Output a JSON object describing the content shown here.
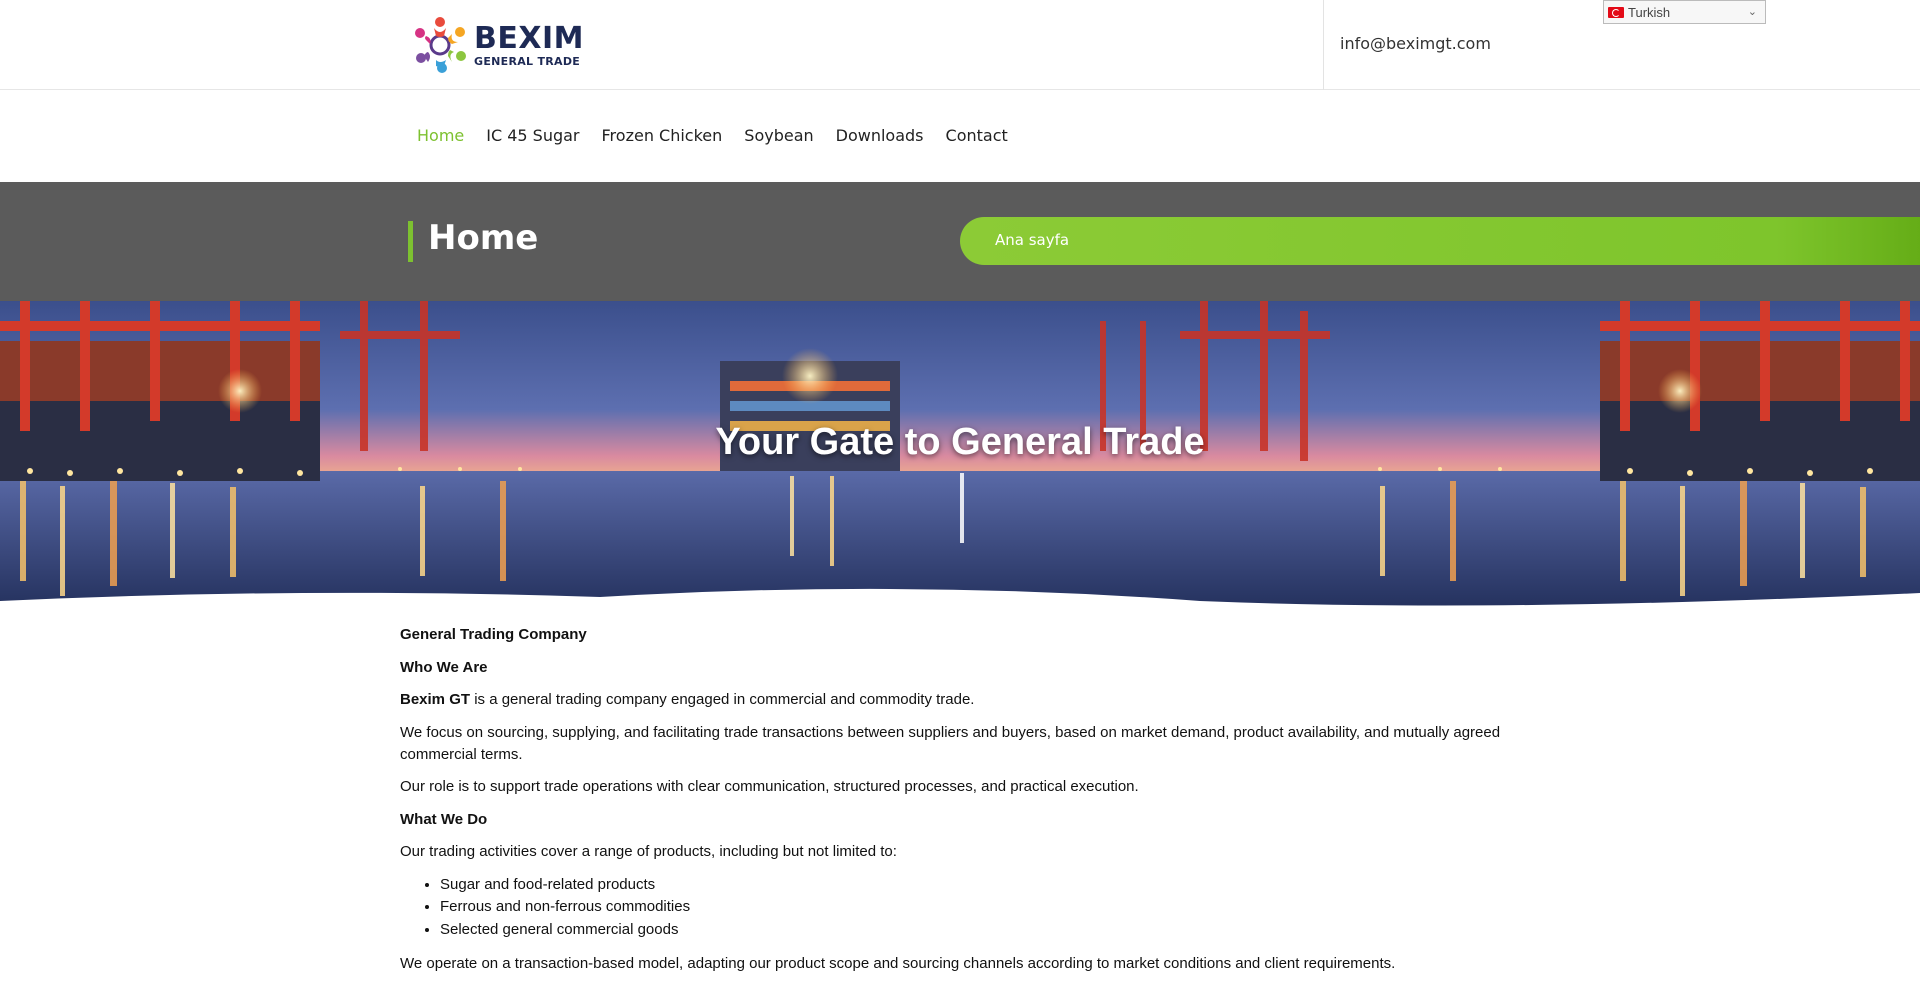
{
  "brand": {
    "word": "BEXIM",
    "subtitle": "GENERAL TRADE"
  },
  "header": {
    "email": "info@beximgt.com",
    "language": {
      "selected": "Turkish"
    }
  },
  "nav": {
    "items": [
      {
        "label": "Home",
        "active": true
      },
      {
        "label": "IC 45 Sugar",
        "active": false
      },
      {
        "label": "Frozen Chicken",
        "active": false
      },
      {
        "label": "Soybean",
        "active": false
      },
      {
        "label": "Downloads",
        "active": false
      },
      {
        "label": "Contact",
        "active": false
      }
    ]
  },
  "title_band": {
    "title": "Home",
    "breadcrumb": "Ana sayfa"
  },
  "hero": {
    "heading": "Your Gate to General Trade"
  },
  "content": {
    "heading1": "General Trading Company",
    "heading2": "Who We Are",
    "intro_bold": "Bexim GT",
    "intro_rest": " is a general trading company engaged in commercial and commodity trade.",
    "para_focus": "We focus on sourcing, supplying, and facilitating trade transactions between suppliers and buyers, based on market demand, product availability, and mutually agreed commercial terms.",
    "para_role": "Our role is to support trade operations with clear communication, structured processes, and practical execution.",
    "heading3": "What We Do",
    "para_activities": "Our trading activities cover a range of products, including but not limited to:",
    "products": [
      "Sugar and food-related products",
      "Ferrous and non-ferrous commodities",
      "Selected general commercial goods"
    ],
    "para_model": "We operate on a transaction-based model, adapting our product scope and sourcing channels according to market conditions and client requirements."
  },
  "colors": {
    "accent": "#7dc130",
    "title_band": "#5b5b5b",
    "brand_navy": "#1e2a55"
  }
}
